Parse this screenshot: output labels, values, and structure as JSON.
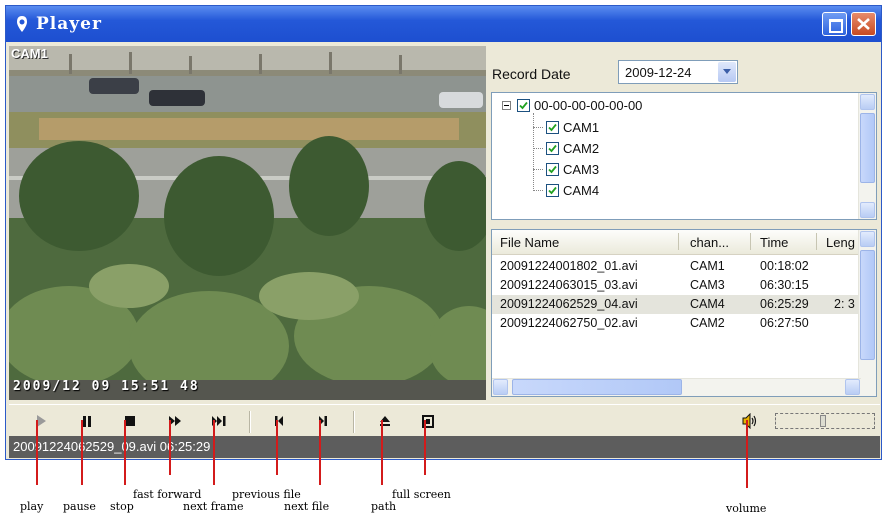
{
  "window": {
    "title": "Player"
  },
  "video": {
    "camera_label": "CAM1",
    "osd_timestamp": "2009/12 09 15:51 48"
  },
  "record_date": {
    "label": "Record Date",
    "value": "2009-12-24"
  },
  "tree": {
    "root": "00-00-00-00-00-00",
    "cameras": [
      "CAM1",
      "CAM2",
      "CAM3",
      "CAM4"
    ]
  },
  "file_list": {
    "columns": [
      "File Name",
      "chan...",
      "Time",
      "Leng"
    ],
    "rows": [
      {
        "name": "20091224001802_01.avi",
        "channel": "CAM1",
        "time": "00:18:02",
        "length": ""
      },
      {
        "name": "20091224063015_03.avi",
        "channel": "CAM3",
        "time": "06:30:15",
        "length": ""
      },
      {
        "name": "20091224062529_04.avi",
        "channel": "CAM4",
        "time": "06:25:29",
        "length": "2: 3"
      },
      {
        "name": "20091224062750_02.avi",
        "channel": "CAM2",
        "time": "06:27:50",
        "length": ""
      }
    ],
    "selected_index": 2
  },
  "status": {
    "text": "20091224062529_09.avi  06:25:29"
  },
  "annotations": {
    "play": "play",
    "pause": "pause",
    "stop": "stop",
    "fast_forward": "fast forward",
    "next_frame": "next frame",
    "previous_file": "previous file",
    "next_file": "next file",
    "path": "path",
    "full_screen": "full screen",
    "volume": "volume"
  },
  "colors": {
    "titlebar": "#2458d8",
    "lead_lines": "#d31b1b",
    "status_bg": "#5d5d5d"
  }
}
